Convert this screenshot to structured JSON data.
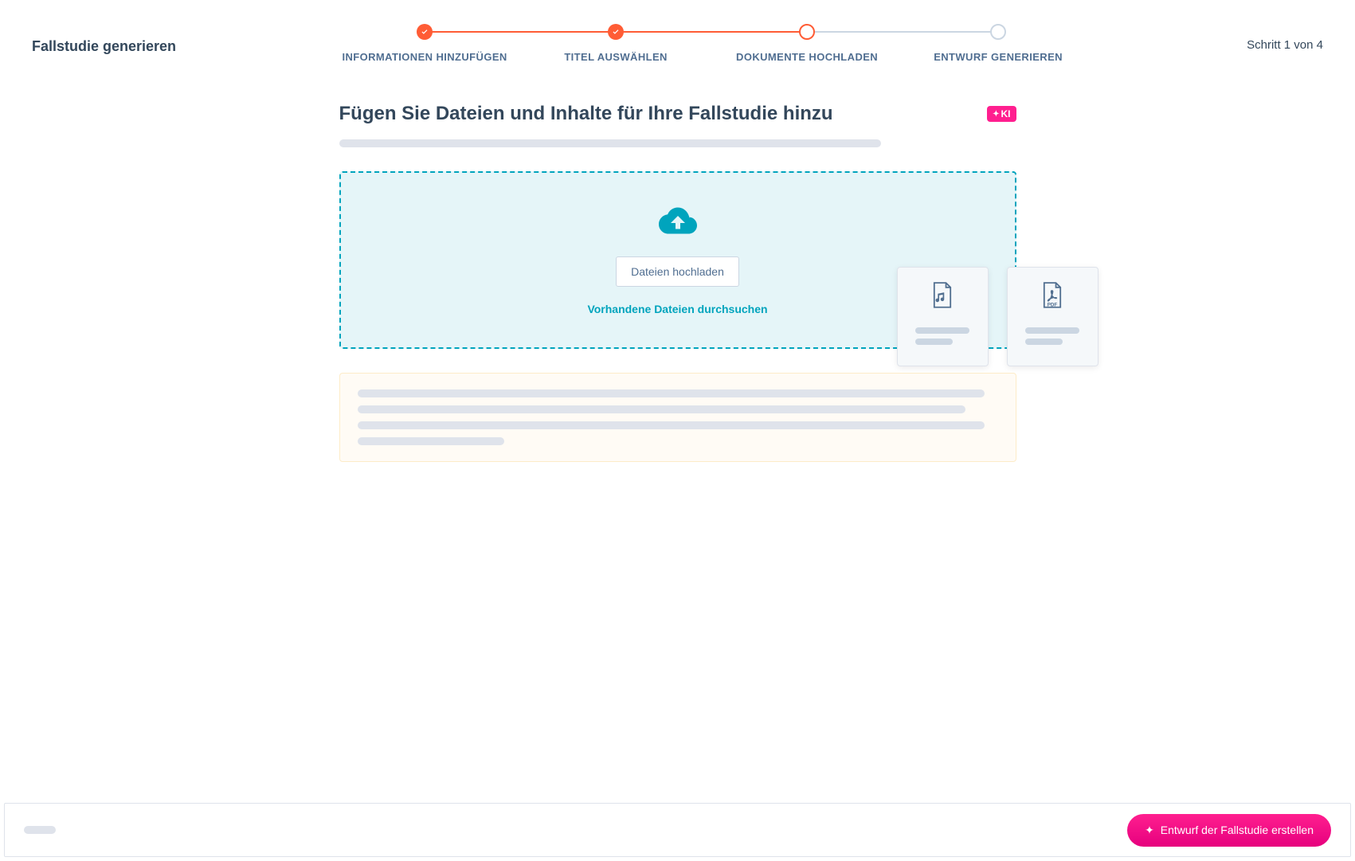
{
  "header": {
    "title": "Fallstudie generieren",
    "step_counter": "Schritt 1 von 4"
  },
  "stepper": [
    {
      "label": "INFORMATIONEN HINZUFÜGEN",
      "state": "done"
    },
    {
      "label": "TITEL AUSWÄHLEN",
      "state": "done"
    },
    {
      "label": "DOKUMENTE HOCHLADEN",
      "state": "active"
    },
    {
      "label": "ENTWURF GENERIEREN",
      "state": "inactive"
    }
  ],
  "page": {
    "title": "Fügen Sie Dateien und Inhalte für Ihre Fallstudie hinzu",
    "ki_badge": "KI"
  },
  "upload": {
    "button_label": "Dateien hochladen",
    "browse_link": "Vorhandene Dateien durchsuchen"
  },
  "file_cards": {
    "music": {
      "type": "audio"
    },
    "pdf": {
      "type": "pdf",
      "label": "PDF"
    }
  },
  "footer": {
    "primary_button": "Entwurf der Fallstudie erstellen"
  }
}
